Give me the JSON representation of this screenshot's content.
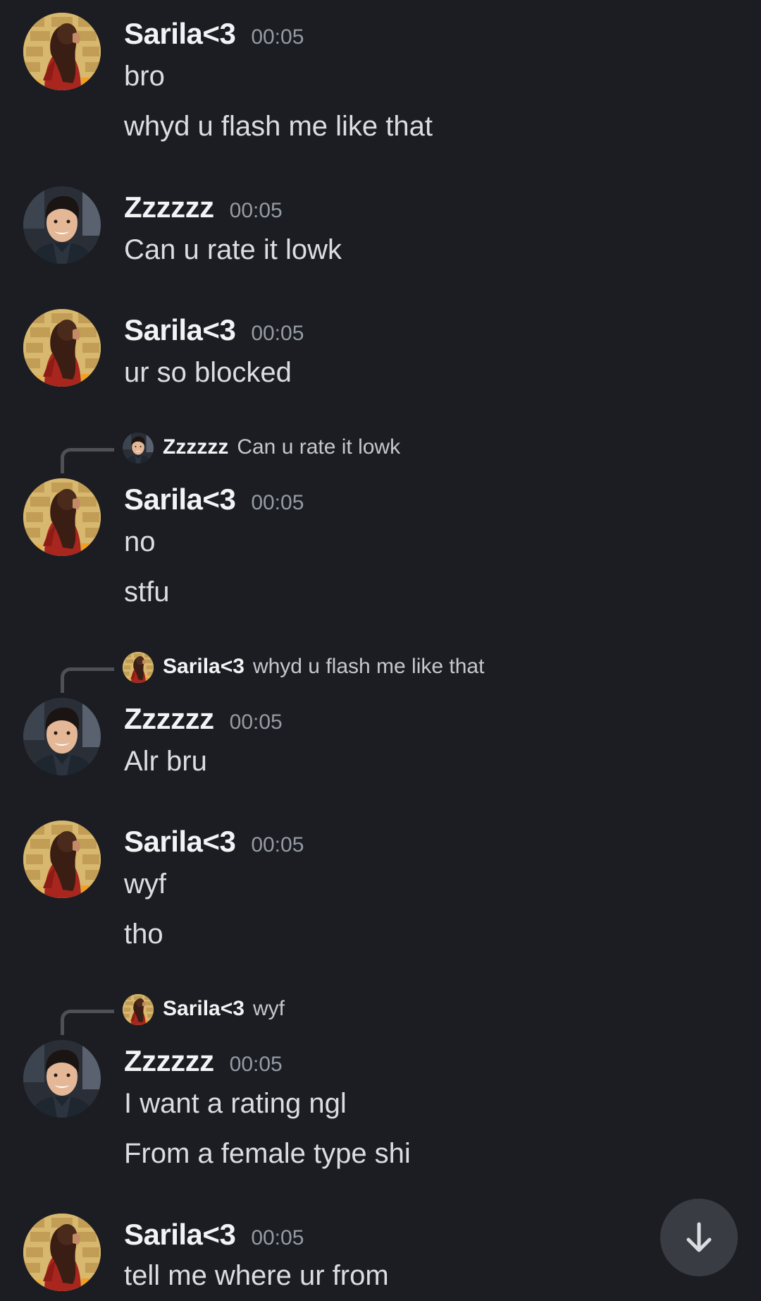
{
  "messages": [
    {
      "author": "Sarila<3",
      "time": "00:05",
      "avatar": "sarila-avatar",
      "lines": [
        "bro",
        "whyd u flash me like that"
      ]
    },
    {
      "author": "Zzzzzz",
      "time": "00:05",
      "avatar": "zzzzzz-avatar",
      "lines": [
        "Can u rate it lowk"
      ]
    },
    {
      "author": "Sarila<3",
      "time": "00:05",
      "avatar": "sarila-avatar",
      "lines": [
        "ur so blocked"
      ]
    },
    {
      "author": "Sarila<3",
      "time": "00:05",
      "avatar": "sarila-avatar",
      "reply": {
        "author": "Zzzzzz",
        "text": "Can u rate it lowk"
      },
      "lines": [
        "no",
        "stfu"
      ]
    },
    {
      "author": "Zzzzzz",
      "time": "00:05",
      "avatar": "zzzzzz-avatar",
      "reply": {
        "author": "Sarila<3",
        "text": "whyd u flash me like that"
      },
      "lines": [
        "Alr bru"
      ]
    },
    {
      "author": "Sarila<3",
      "time": "00:05",
      "avatar": "sarila-avatar",
      "lines": [
        "wyf",
        "tho"
      ]
    },
    {
      "author": "Zzzzzz",
      "time": "00:05",
      "avatar": "zzzzzz-avatar",
      "reply": {
        "author": "Sarila<3",
        "text": "wyf"
      },
      "lines": [
        "I want a rating ngl",
        "From a female type shi"
      ]
    },
    {
      "author": "Sarila<3",
      "time": "00:05",
      "avatar": "sarila-avatar",
      "lines": [
        "tell me where ur from"
      ]
    }
  ],
  "jump_button": {
    "icon": "arrow-down-icon"
  },
  "colors": {
    "background": "#1c1d22",
    "username": "#f2f3f5",
    "text": "#dbdee1",
    "timestamp": "#949ba4",
    "button": "#3a3c43"
  }
}
